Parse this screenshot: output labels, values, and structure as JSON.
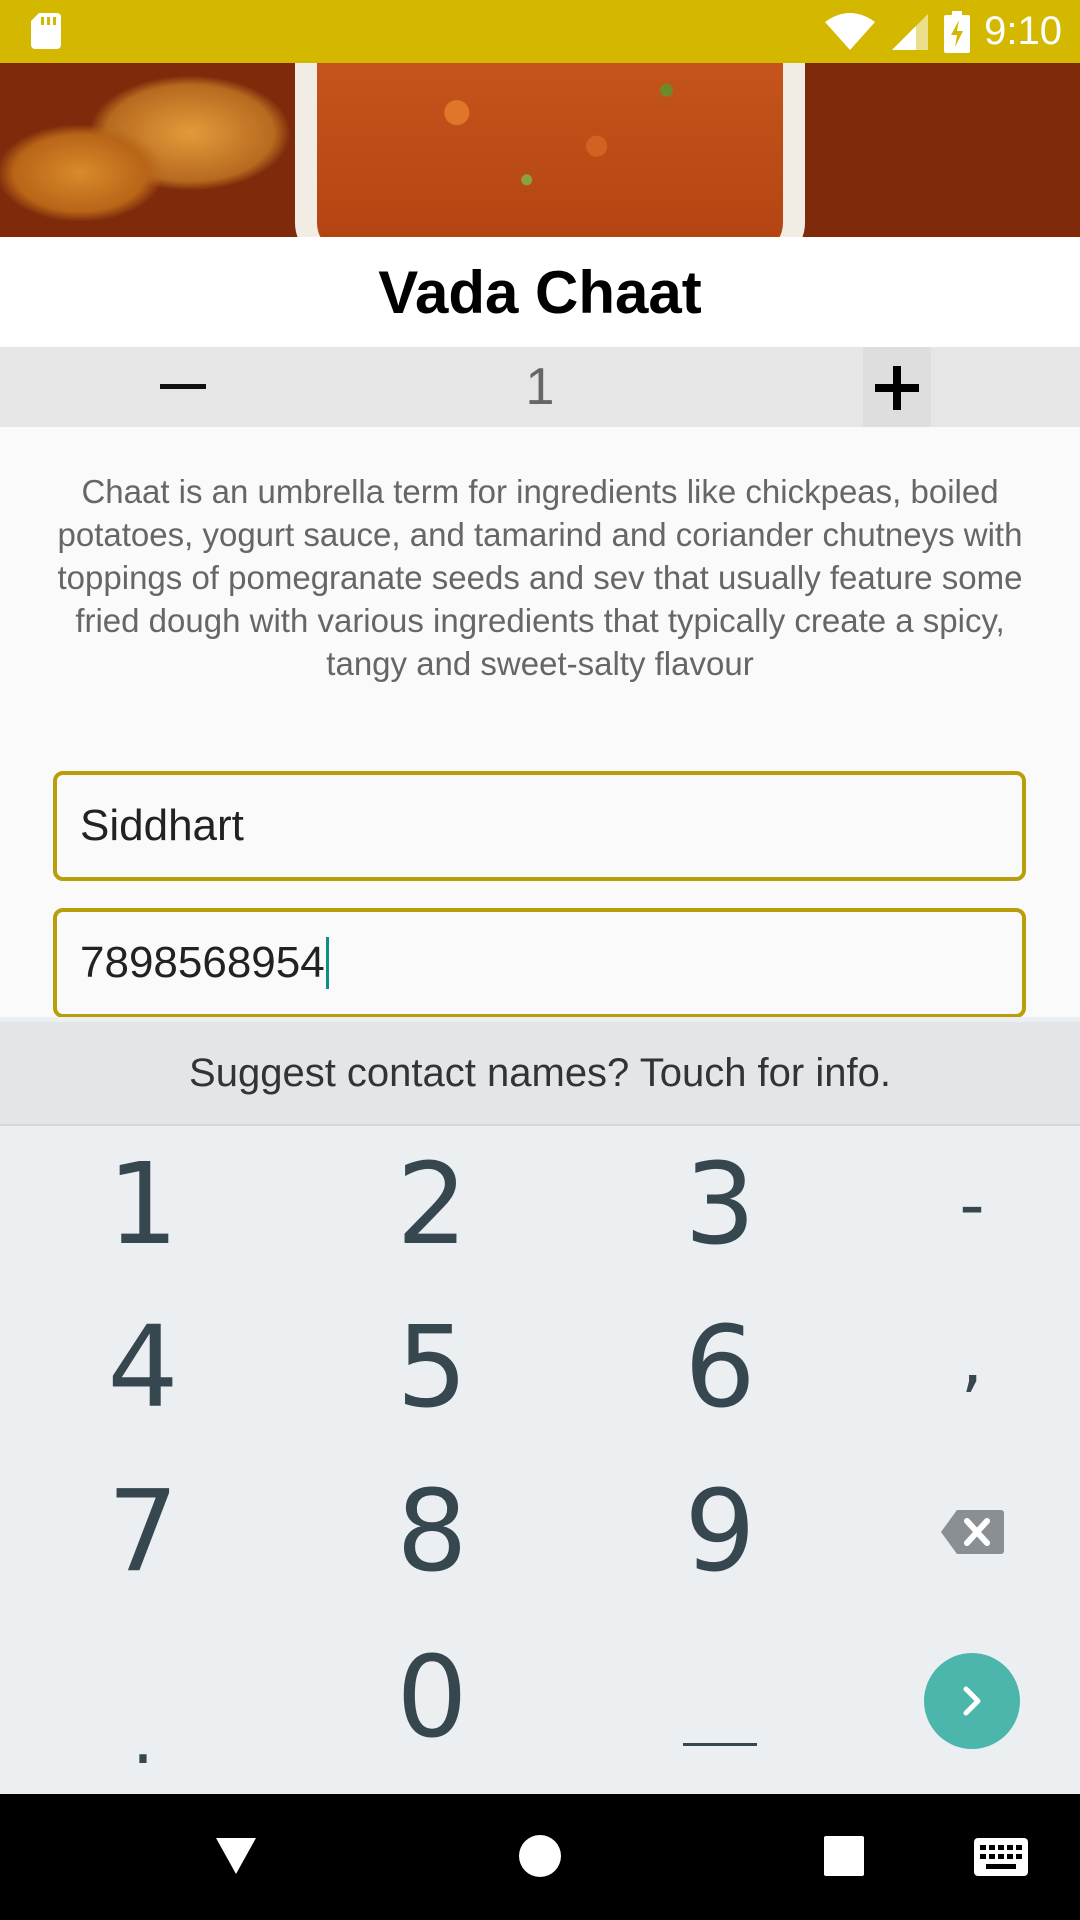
{
  "status_bar": {
    "time": "9:10",
    "icons": [
      "sd-card-icon",
      "wifi-icon",
      "cell-signal-icon",
      "battery-charging-icon"
    ]
  },
  "product": {
    "title": "Vada Chaat",
    "quantity": "1",
    "description": "Chaat is an umbrella term for ingredients like chickpeas, boiled potatoes, yogurt sauce, and tamarind and coriander chutneys with toppings of pomegranate seeds and sev  that usually feature some fried dough with various ingredients that typically create a spicy, tangy and sweet-salty flavour"
  },
  "form": {
    "name_value": "Siddhart",
    "phone_value": "7898568954"
  },
  "keyboard": {
    "suggestion": "Suggest contact names? Touch for info.",
    "keys": {
      "k1": "1",
      "k2": "2",
      "k3": "3",
      "dash": "-",
      "k4": "4",
      "k5": "5",
      "k6": "6",
      "comma": ",",
      "k7": "7",
      "k8": "8",
      "k9": "9",
      "dot": ".",
      "k0": "0",
      "space": "__"
    }
  },
  "colors": {
    "status_bar": "#d4b800",
    "field_border": "#b79e0a",
    "accent": "#4db6ac"
  }
}
